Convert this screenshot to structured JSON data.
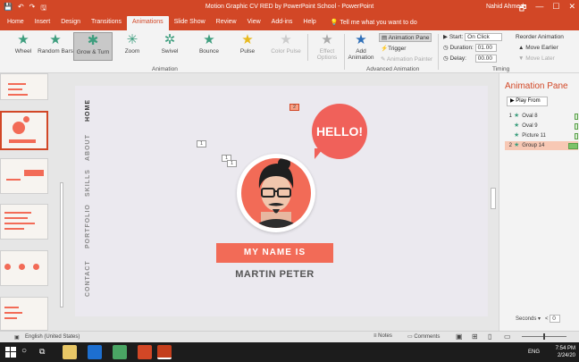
{
  "titlebar": {
    "title": "Motion Graphic CV RED by PowerPoint School  -  PowerPoint",
    "user": "Nahid Ahmed",
    "quick_access": [
      "💾",
      "↶",
      "↷",
      "🖫"
    ],
    "window_controls": [
      "🗗",
      "—",
      "☐",
      "✕"
    ]
  },
  "tabs": [
    "Home",
    "Insert",
    "Design",
    "Transitions",
    "Animations",
    "Slide Show",
    "Review",
    "View",
    "Add-ins",
    "Help"
  ],
  "active_tab": "Animations",
  "tell_me": "Tell me what you want to do",
  "ribbon": {
    "effects": [
      {
        "label": "Wheel",
        "state": "normal",
        "color": "#3e9e7e"
      },
      {
        "label": "Random Bars",
        "state": "normal",
        "color": "#3e9e7e"
      },
      {
        "label": "Grow & Turn",
        "state": "selected",
        "color": "#3e9e7e"
      },
      {
        "label": "Zoom",
        "state": "normal",
        "color": "#3e9e7e"
      },
      {
        "label": "Swivel",
        "state": "normal",
        "color": "#3e9e7e"
      },
      {
        "label": "Bounce",
        "state": "normal",
        "color": "#3e9e7e"
      },
      {
        "label": "Pulse",
        "state": "normal",
        "color": "#e8b91e"
      },
      {
        "label": "Color Pulse",
        "state": "disabled",
        "color": "#cccccc"
      }
    ],
    "effect_options": "Effect Options",
    "animation_group": "Animation",
    "add_animation": "Add Animation",
    "animation_pane_btn": "Animation Pane",
    "trigger": "Trigger",
    "animation_painter": "Animation Painter",
    "advanced_group": "Advanced Animation",
    "start_label": "Start:",
    "start_value": "On Click",
    "duration_label": "Duration:",
    "duration_value": "01.00",
    "delay_label": "Delay:",
    "delay_value": "00.00",
    "reorder": "Reorder Animation",
    "move_earlier": "Move Earlier",
    "move_later": "Move Later",
    "timing_group": "Timing"
  },
  "slide": {
    "nav": [
      "HOME",
      "ABOUT",
      "SKILLS",
      "PORTFOLIO",
      "CONTACT"
    ],
    "hello": "HELLO!",
    "my_name_is": "MY NAME IS",
    "full_name": "MARTIN PETER",
    "anim_tags": [
      "2",
      "1",
      "1",
      "1"
    ]
  },
  "animation_pane": {
    "title": "Animation Pane",
    "play_from": "Play From",
    "items": [
      {
        "num": "1",
        "name": "Oval 8",
        "selected": false
      },
      {
        "num": "",
        "name": "Oval 9",
        "selected": false
      },
      {
        "num": "",
        "name": "Picture 11",
        "selected": false
      },
      {
        "num": "2",
        "name": "Group 14",
        "selected": true
      }
    ],
    "seconds_label": "Seconds",
    "seconds_value": "0"
  },
  "statusbar": {
    "slide_info": "",
    "language": "English (United States)",
    "notes": "Notes",
    "comments": "Comments"
  },
  "taskbar": {
    "lang": "ENG",
    "time": "7:54 PM",
    "date": "2/24/20"
  }
}
